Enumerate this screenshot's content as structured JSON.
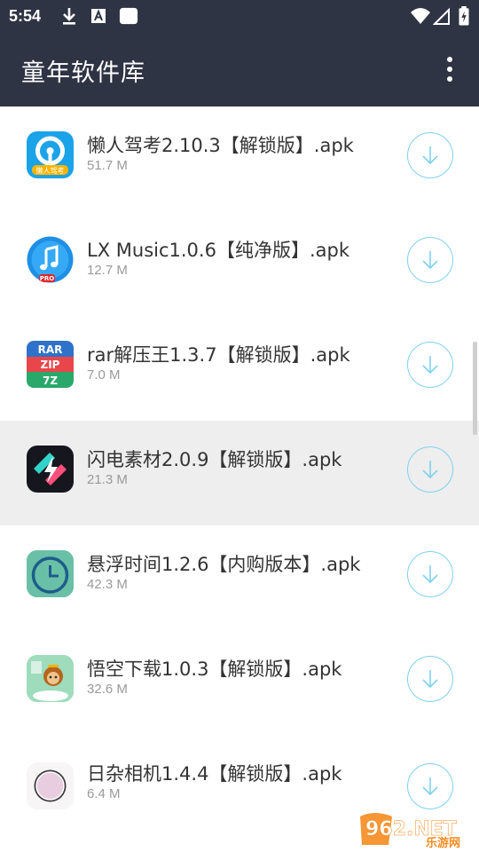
{
  "status_bar": {
    "time": "5:54",
    "icons": [
      "download-icon",
      "keyboard-a-icon",
      "square-icon",
      "wifi-icon",
      "signal-icon",
      "battery-charging-icon"
    ]
  },
  "app_bar": {
    "title": "童年软件库",
    "menu_icon": "more-vert-icon"
  },
  "apps": [
    {
      "name": "懒人驾考2.10.3【解锁版】.apk",
      "size": "51.7 M",
      "icon": "lazy-driving-icon",
      "icon_text": "懒人驾考"
    },
    {
      "name": "LX Music1.0.6【纯净版】.apk",
      "size": "12.7 M",
      "icon": "music-note-icon",
      "icon_text": "PRO"
    },
    {
      "name": "rar解压王1.3.7【解锁版】.apk",
      "size": "7.0 M",
      "icon": "rar-zip-icon",
      "icon_text": [
        "RAR",
        "ZIP",
        "7Z"
      ]
    },
    {
      "name": "闪电素材2.0.9【解锁版】.apk",
      "size": "21.3 M",
      "icon": "lightning-material-icon",
      "highlighted": true
    },
    {
      "name": "悬浮时间1.2.6【内购版本】.apk",
      "size": "42.3 M",
      "icon": "clock-icon"
    },
    {
      "name": "悟空下载1.0.3【解锁版】.apk",
      "size": "32.6 M",
      "icon": "monkey-king-icon"
    },
    {
      "name": "日杂相机1.4.4【解锁版】.apk",
      "size": "6.4 M",
      "icon": "camera-lens-icon"
    }
  ],
  "watermark": {
    "brand": "962.NET",
    "sub": "乐游网"
  },
  "colors": {
    "app_bar": "#2f3444",
    "accent": "#7fd1f0",
    "text": "#333333",
    "subtext": "#9a9a9a",
    "highlight_row": "#eeeeee"
  }
}
